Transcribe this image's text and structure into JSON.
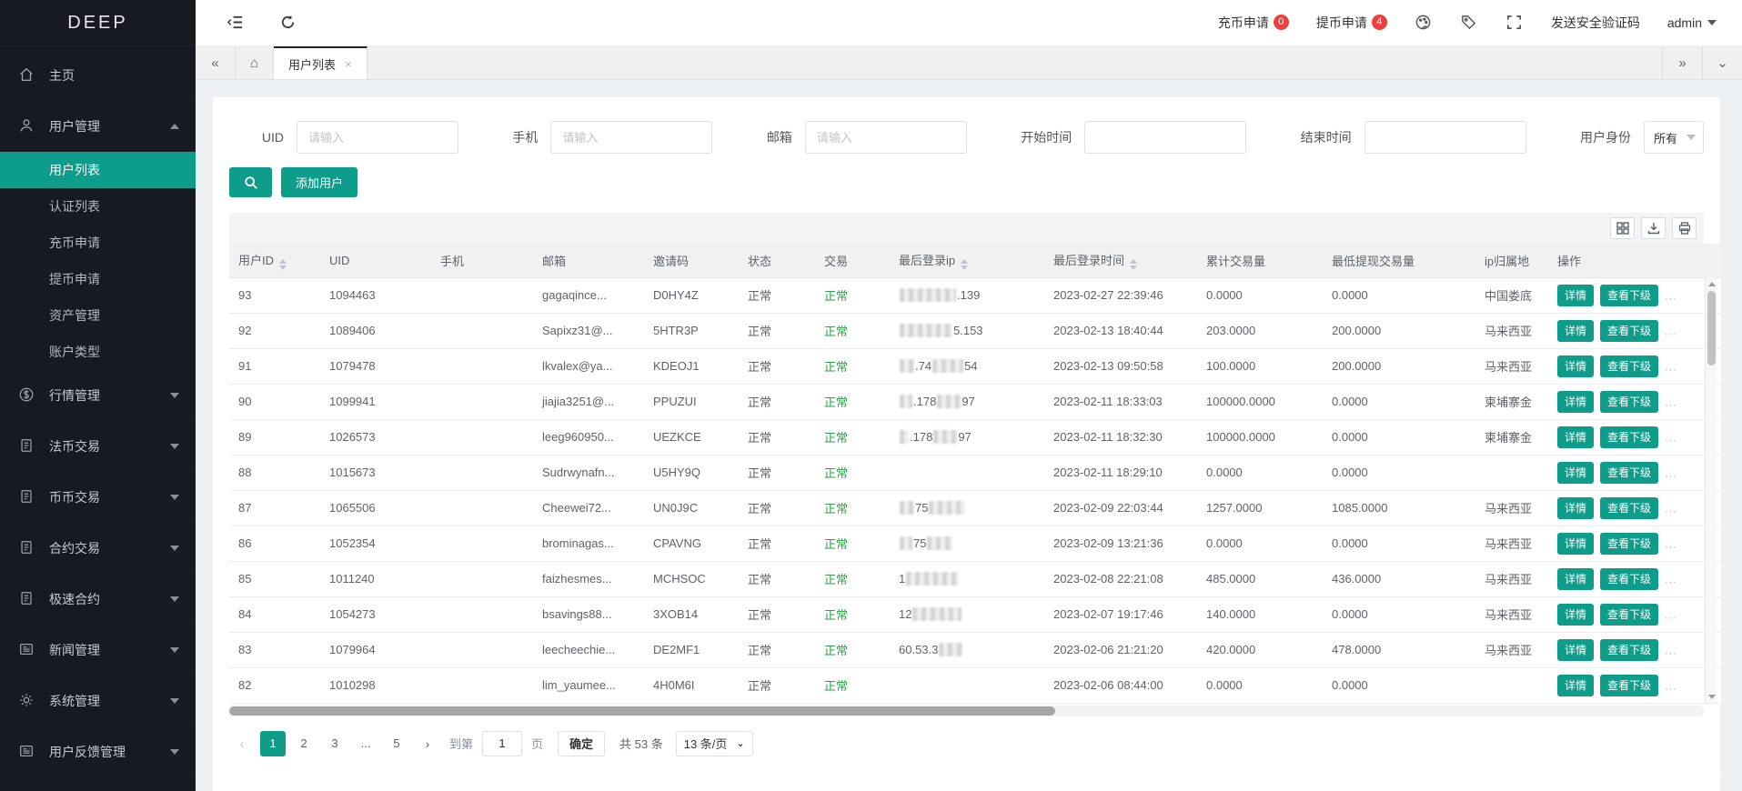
{
  "app": {
    "logo": "DEEP"
  },
  "topbar": {
    "deposit": {
      "label": "充币申请",
      "badge": "0"
    },
    "withdraw": {
      "label": "提币申请",
      "badge": "4"
    },
    "send_code_label": "发送安全验证码",
    "user_label": "admin"
  },
  "tabbar": {
    "active_tab": "用户列表"
  },
  "sidebar": {
    "items": [
      {
        "label": "主页",
        "icon": "home-icon",
        "collapsible": false
      },
      {
        "label": "用户管理",
        "icon": "user-icon",
        "collapsible": true,
        "expanded": true,
        "children": [
          {
            "label": "用户列表",
            "active": true
          },
          {
            "label": "认证列表",
            "active": false
          },
          {
            "label": "充币申请",
            "active": false
          },
          {
            "label": "提币申请",
            "active": false
          },
          {
            "label": "资产管理",
            "active": false
          },
          {
            "label": "账户类型",
            "active": false
          }
        ]
      },
      {
        "label": "行情管理",
        "icon": "dollar-icon",
        "collapsible": true,
        "expanded": false
      },
      {
        "label": "法币交易",
        "icon": "doc-icon",
        "collapsible": true,
        "expanded": false
      },
      {
        "label": "币币交易",
        "icon": "doc-icon",
        "collapsible": true,
        "expanded": false
      },
      {
        "label": "合约交易",
        "icon": "doc-icon",
        "collapsible": true,
        "expanded": false
      },
      {
        "label": "极速合约",
        "icon": "doc-icon",
        "collapsible": true,
        "expanded": false
      },
      {
        "label": "新闻管理",
        "icon": "news-icon",
        "collapsible": true,
        "expanded": false
      },
      {
        "label": "系统管理",
        "icon": "gear-icon",
        "collapsible": true,
        "expanded": false
      },
      {
        "label": "用户反馈管理",
        "icon": "news-icon",
        "collapsible": true,
        "expanded": false
      }
    ]
  },
  "filters": {
    "fields": [
      {
        "label": "UID",
        "placeholder": "请输入",
        "value": ""
      },
      {
        "label": "手机",
        "placeholder": "请输入",
        "value": ""
      },
      {
        "label": "邮箱",
        "placeholder": "请输入",
        "value": ""
      },
      {
        "label": "开始时间",
        "placeholder": "",
        "value": ""
      },
      {
        "label": "结束时间",
        "placeholder": "",
        "value": ""
      },
      {
        "label": "用户身份",
        "value": "所有"
      }
    ],
    "add_user_label": "添加用户"
  },
  "table": {
    "columns": [
      {
        "label": "用户ID",
        "sortable": true
      },
      {
        "label": "UID",
        "sortable": false
      },
      {
        "label": "手机",
        "sortable": false
      },
      {
        "label": "邮箱",
        "sortable": false
      },
      {
        "label": "邀请码",
        "sortable": false
      },
      {
        "label": "状态",
        "sortable": false
      },
      {
        "label": "交易",
        "sortable": false
      },
      {
        "label": "最后登录ip",
        "sortable": true
      },
      {
        "label": "最后登录时间",
        "sortable": true
      },
      {
        "label": "累计交易量",
        "sortable": false
      },
      {
        "label": "最低提现交易量",
        "sortable": false
      },
      {
        "label": "ip归属地",
        "sortable": false
      },
      {
        "label": "操作",
        "sortable": false
      }
    ],
    "action_labels": {
      "detail": "详情",
      "subordinates": "查看下级",
      "more": "..."
    },
    "rows": [
      {
        "id": "93",
        "uid": "1094463",
        "phone": "",
        "email": "gagaqince...",
        "code": "D0HY4Z",
        "status": "正常",
        "trade": "正常",
        "ip": [
          {
            "b": 62
          },
          {
            "t": ".139"
          }
        ],
        "login_time": "2023-02-27 22:39:46",
        "volume": "0.0000",
        "min_withdraw": "0.0000",
        "ip_location": "中国娄底"
      },
      {
        "id": "92",
        "uid": "1089406",
        "phone": "",
        "email": "Sapixz31@...",
        "code": "5HTR3P",
        "status": "正常",
        "trade": "正常",
        "ip": [
          {
            "b": 58
          },
          {
            "t": "5.153"
          }
        ],
        "login_time": "2023-02-13 18:40:44",
        "volume": "203.0000",
        "min_withdraw": "200.0000",
        "ip_location": "马来西亚"
      },
      {
        "id": "91",
        "uid": "1079478",
        "phone": "",
        "email": "lkvalex@ya...",
        "code": "KDEOJ1",
        "status": "正常",
        "trade": "正常",
        "ip": [
          {
            "b": 16
          },
          {
            "t": ".74"
          },
          {
            "b": 34
          },
          {
            "t": "54"
          }
        ],
        "login_time": "2023-02-13 09:50:58",
        "volume": "100.0000",
        "min_withdraw": "200.0000",
        "ip_location": "马来西亚"
      },
      {
        "id": "90",
        "uid": "1099941",
        "phone": "",
        "email": "jiajia3251@...",
        "code": "PPUZUI",
        "status": "正常",
        "trade": "正常",
        "ip": [
          {
            "b": 14
          },
          {
            "t": ".178"
          },
          {
            "b": 26
          },
          {
            "t": "97"
          }
        ],
        "login_time": "2023-02-11 18:33:03",
        "volume": "100000.0000",
        "min_withdraw": "0.0000",
        "ip_location": "柬埔寨金"
      },
      {
        "id": "89",
        "uid": "1026573",
        "phone": "",
        "email": "leeg960950...",
        "code": "UEZKCE",
        "status": "正常",
        "trade": "正常",
        "ip": [
          {
            "b": 10
          },
          {
            "t": ".178"
          },
          {
            "b": 26
          },
          {
            "t": "97"
          }
        ],
        "login_time": "2023-02-11 18:32:30",
        "volume": "100000.0000",
        "min_withdraw": "0.0000",
        "ip_location": "柬埔寨金"
      },
      {
        "id": "88",
        "uid": "1015673",
        "phone": "",
        "email": "Sudrwynafn...",
        "code": "U5HY9Q",
        "status": "正常",
        "trade": "正常",
        "ip": [],
        "login_time": "2023-02-11 18:29:10",
        "volume": "0.0000",
        "min_withdraw": "0.0000",
        "ip_location": ""
      },
      {
        "id": "87",
        "uid": "1065506",
        "phone": "",
        "email": "Cheewei72...",
        "code": "UN0J9C",
        "status": "正常",
        "trade": "正常",
        "ip": [
          {
            "b": 16
          },
          {
            "t": "75"
          },
          {
            "b": 40
          }
        ],
        "login_time": "2023-02-09 22:03:44",
        "volume": "1257.0000",
        "min_withdraw": "1085.0000",
        "ip_location": "马来西亚"
      },
      {
        "id": "86",
        "uid": "1052354",
        "phone": "",
        "email": "brominagas...",
        "code": "CPAVNG",
        "status": "正常",
        "trade": "正常",
        "ip": [
          {
            "b": 14
          },
          {
            "t": "75"
          },
          {
            "b": 28
          }
        ],
        "login_time": "2023-02-09 13:21:36",
        "volume": "0.0000",
        "min_withdraw": "0.0000",
        "ip_location": "马来西亚"
      },
      {
        "id": "85",
        "uid": "1011240",
        "phone": "",
        "email": "faizhesmes...",
        "code": "MCHSOC",
        "status": "正常",
        "trade": "正常",
        "ip": [
          {
            "t": "1"
          },
          {
            "b": 58
          }
        ],
        "login_time": "2023-02-08 22:21:08",
        "volume": "485.0000",
        "min_withdraw": "436.0000",
        "ip_location": "马来西亚"
      },
      {
        "id": "84",
        "uid": "1054273",
        "phone": "",
        "email": "bsavings88...",
        "code": "3XOB14",
        "status": "正常",
        "trade": "正常",
        "ip": [
          {
            "t": "12"
          },
          {
            "b": 54
          }
        ],
        "login_time": "2023-02-07 19:17:46",
        "volume": "140.0000",
        "min_withdraw": "0.0000",
        "ip_location": "马来西亚"
      },
      {
        "id": "83",
        "uid": "1079964",
        "phone": "",
        "email": "leecheechie...",
        "code": "DE2MF1",
        "status": "正常",
        "trade": "正常",
        "ip": [
          {
            "t": "60.53.3"
          },
          {
            "b": 26
          }
        ],
        "login_time": "2023-02-06 21:21:20",
        "volume": "420.0000",
        "min_withdraw": "478.0000",
        "ip_location": "马来西亚"
      },
      {
        "id": "82",
        "uid": "1010298",
        "phone": "",
        "email": "lim_yaumee...",
        "code": "4H0M6I",
        "status": "正常",
        "trade": "正常",
        "ip": [],
        "login_time": "2023-02-06 08:44:00",
        "volume": "0.0000",
        "min_withdraw": "0.0000",
        "ip_location": ""
      }
    ]
  },
  "pagination": {
    "pages": [
      "1",
      "2",
      "3",
      "...",
      "5"
    ],
    "active": "1",
    "goto_label": "到第",
    "goto_value": "1",
    "page_unit": "页",
    "confirm_label": "确定",
    "total_label": "共 53 条",
    "page_size_label": "13 条/页"
  },
  "colors": {
    "accent_teal": "#0e9d8a",
    "badge_red": "#ee3f3f",
    "trade_green": "#2ba245",
    "sidebar_bg": "#171a21"
  }
}
